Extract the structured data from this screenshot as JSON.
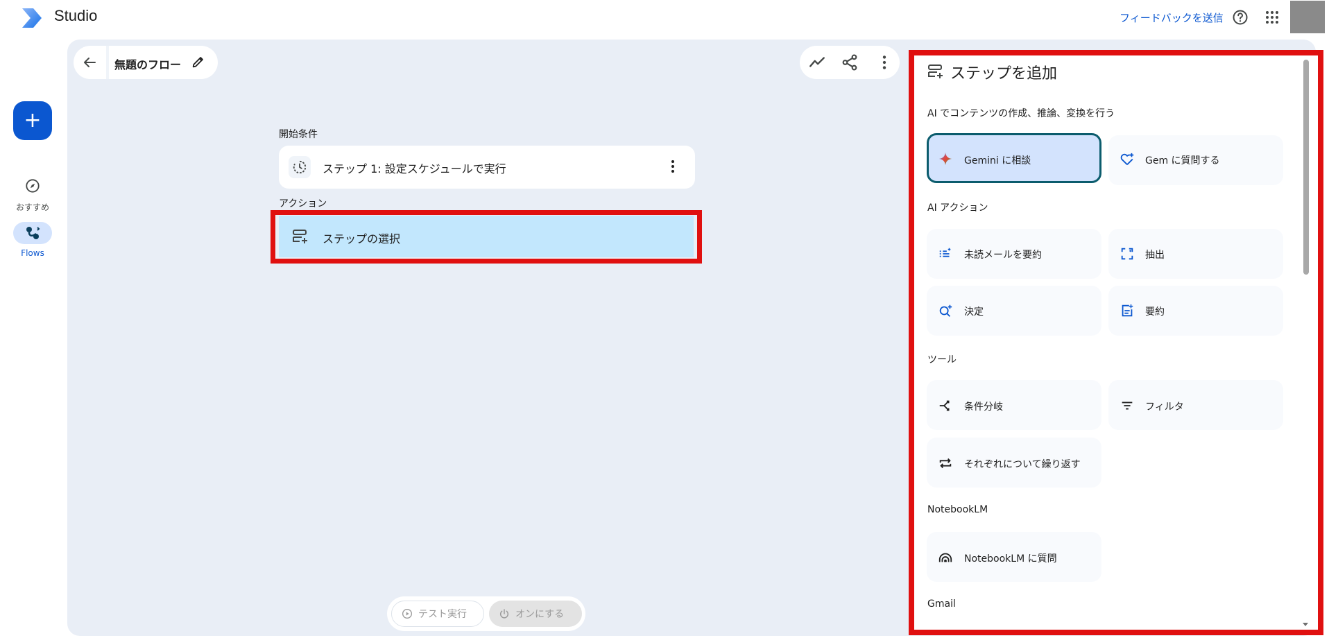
{
  "header": {
    "app_name": "Studio",
    "feedback_label": "フィードバックを送信"
  },
  "rail": {
    "create_label": "+",
    "items": [
      {
        "label": "おすすめ",
        "icon": "compass-icon"
      },
      {
        "label": "Flows",
        "icon": "flows-icon",
        "active": true
      }
    ]
  },
  "flow": {
    "title": "無題のフロー",
    "trigger_section": "開始条件",
    "trigger_step": "ステップ 1: 設定スケジュールで実行",
    "action_section": "アクション",
    "select_step": "ステップの選択",
    "test_button": "テスト実行",
    "on_button": "オンにする"
  },
  "panel": {
    "title": "ステップを追加",
    "sections": [
      {
        "label": "AI でコンテンツの作成、推論、変換を行う",
        "items": [
          {
            "label": "Gemini に相談",
            "icon": "gemini-sparkle-icon",
            "selected": true
          },
          {
            "label": "Gem に質問する",
            "icon": "gem-icon"
          }
        ]
      },
      {
        "label": "AI アクション",
        "items": [
          {
            "label": "未読メールを要約",
            "icon": "summarize-list-icon"
          },
          {
            "label": "抽出",
            "icon": "extract-icon"
          },
          {
            "label": "決定",
            "icon": "decide-icon"
          },
          {
            "label": "要約",
            "icon": "summary-doc-icon"
          }
        ]
      },
      {
        "label": "ツール",
        "items": [
          {
            "label": "条件分岐",
            "icon": "branch-icon"
          },
          {
            "label": "フィルタ",
            "icon": "filter-icon"
          },
          {
            "label": "それぞれについて繰り返す",
            "icon": "repeat-icon"
          }
        ]
      },
      {
        "label": "NotebookLM",
        "items": [
          {
            "label": "NotebookLM に質問",
            "icon": "notebooklm-icon"
          }
        ]
      },
      {
        "label": "Gmail",
        "items": []
      }
    ]
  },
  "colors": {
    "accent": "#0b57d0",
    "highlight_frame": "#e01010",
    "canvas_bg": "#e9eef6",
    "selected_step_bg": "#c2e7fd"
  }
}
